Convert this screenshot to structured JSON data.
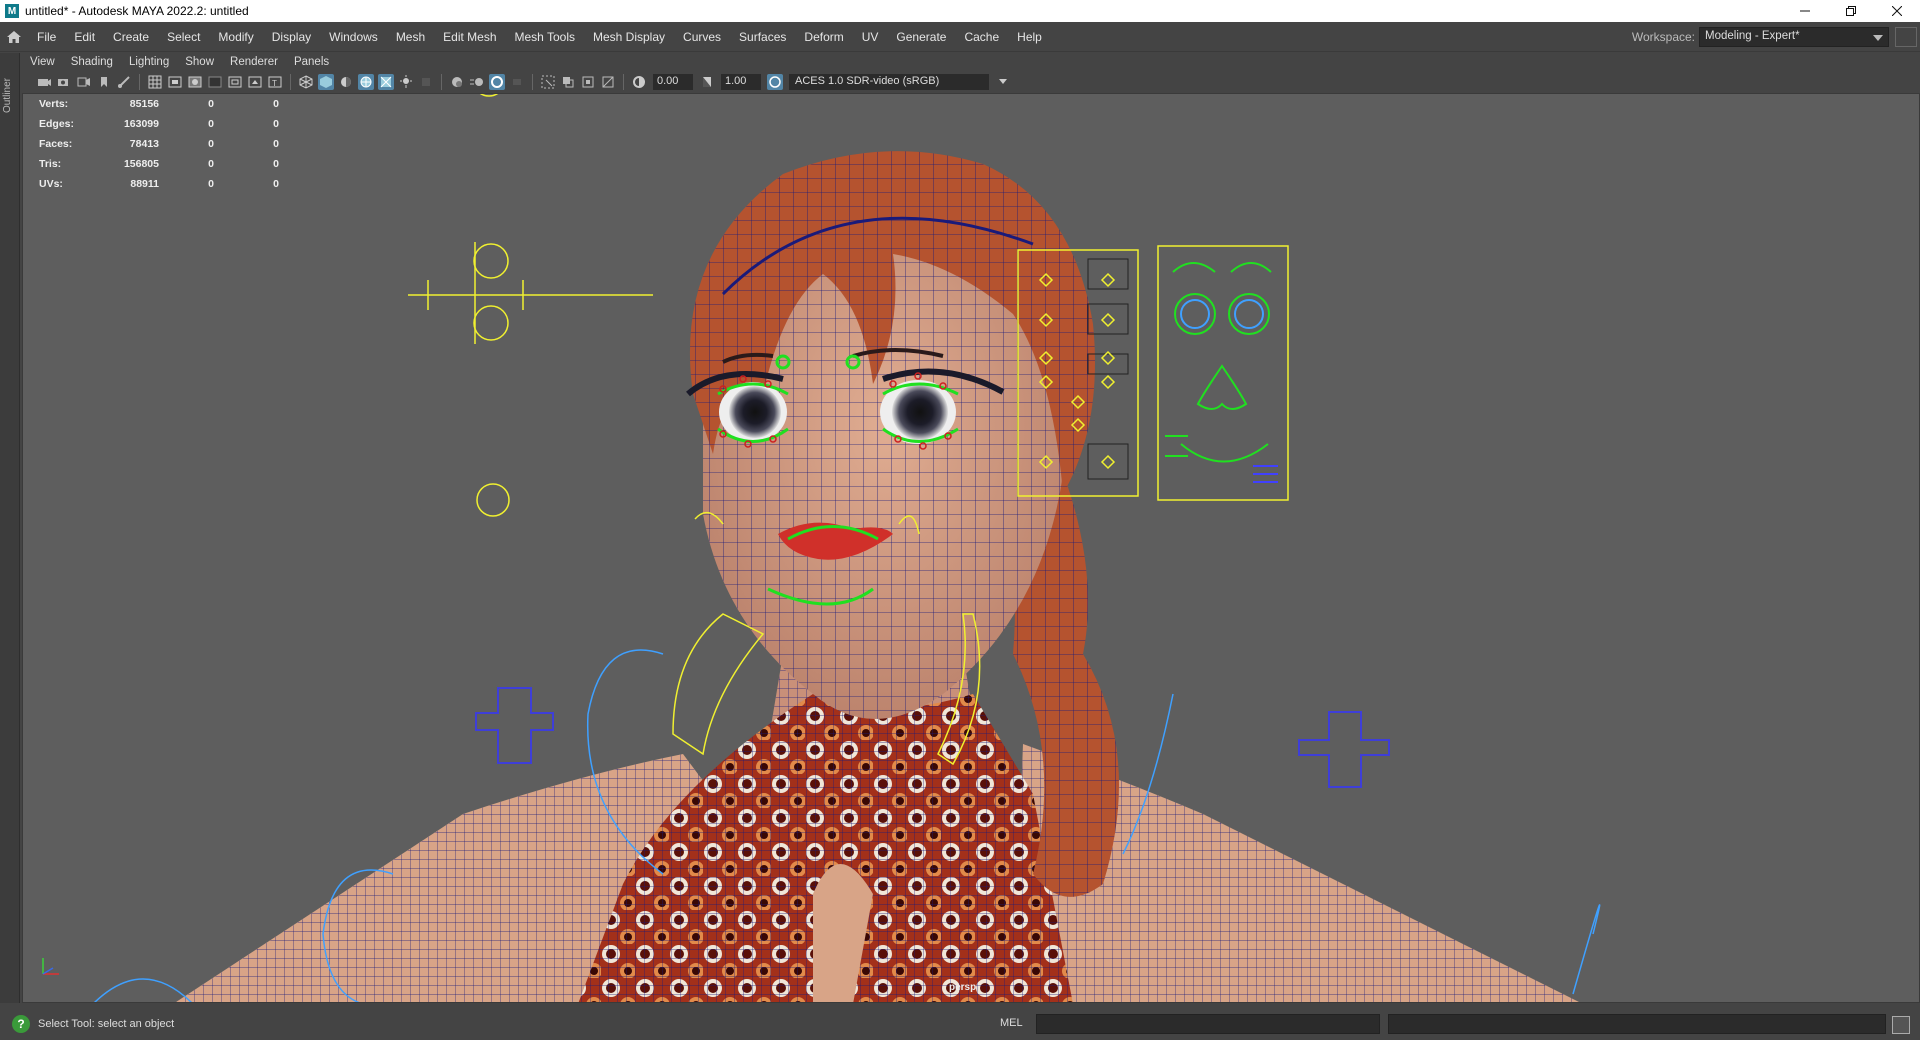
{
  "window": {
    "title": "untitled* - Autodesk MAYA 2022.2: untitled",
    "app_icon": "maya-icon",
    "controls": [
      "minimize-icon",
      "restore-icon",
      "close-icon"
    ]
  },
  "menubar": {
    "items": [
      "File",
      "Edit",
      "Create",
      "Select",
      "Modify",
      "Display",
      "Windows",
      "Mesh",
      "Edit Mesh",
      "Mesh Tools",
      "Mesh Display",
      "Curves",
      "Surfaces",
      "Deform",
      "UV",
      "Generate",
      "Cache",
      "Help"
    ],
    "workspace_label": "Workspace:",
    "workspace_value": "Modeling - Expert*"
  },
  "outliner": {
    "label": "Outliner"
  },
  "panel_menu": {
    "items": [
      "View",
      "Shading",
      "Lighting",
      "Show",
      "Renderer",
      "Panels"
    ]
  },
  "panel_toolbar": {
    "exposure": "0.00",
    "gamma": "1.00",
    "color_management": "ACES 1.0 SDR-video (sRGB)"
  },
  "hud": {
    "rows": [
      {
        "label": "Verts:",
        "value": "85156",
        "sel": "0",
        "comp": "0"
      },
      {
        "label": "Edges:",
        "value": "163099",
        "sel": "0",
        "comp": "0"
      },
      {
        "label": "Faces:",
        "value": "78413",
        "sel": "0",
        "comp": "0"
      },
      {
        "label": "Tris:",
        "value": "156805",
        "sel": "0",
        "comp": "0"
      },
      {
        "label": "UVs:",
        "value": "88911",
        "sel": "0",
        "comp": "0"
      }
    ]
  },
  "viewport": {
    "camera": "persp",
    "background_color": "#5e5e5e",
    "wire_color": "#1a1a7a",
    "control_color": "#f0f030",
    "skin_color": "#d29a7c",
    "hair_color": "#b5532f"
  },
  "statusbar": {
    "help_text": "Select Tool: select an object",
    "mel_label": "MEL"
  }
}
